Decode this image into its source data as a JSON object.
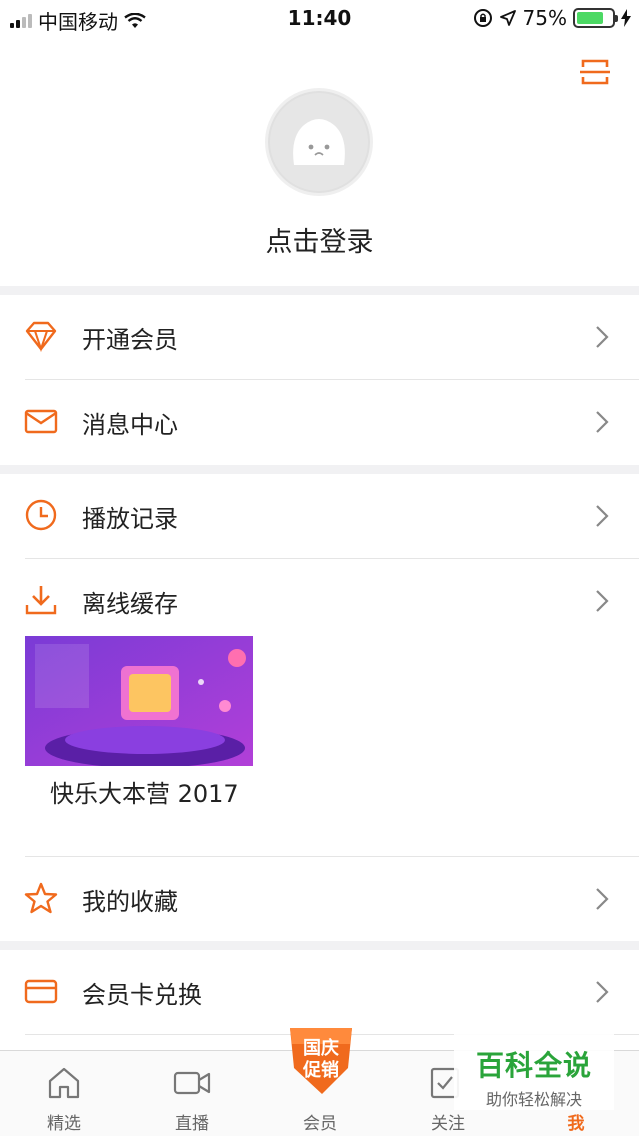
{
  "status_bar": {
    "carrier": "中国移动",
    "time": "11:40",
    "battery_percent": "75%",
    "battery_level": 0.75
  },
  "header": {
    "login_prompt": "点击登录"
  },
  "menu_group_1": [
    {
      "label": "开通会员",
      "icon": "diamond-icon"
    },
    {
      "label": "消息中心",
      "icon": "mail-icon"
    }
  ],
  "menu_group_2": [
    {
      "label": "播放记录",
      "icon": "clock-icon"
    },
    {
      "label": "离线缓存",
      "icon": "download-icon"
    }
  ],
  "offline_video": {
    "title": "快乐大本营 2017"
  },
  "favorites": {
    "label": "我的收藏",
    "icon": "star-icon"
  },
  "menu_group_3": [
    {
      "label": "会员卡兑换",
      "icon": "card-icon"
    }
  ],
  "tab_bar": {
    "tabs": [
      {
        "label": "精选",
        "icon": "home-icon"
      },
      {
        "label": "直播",
        "icon": "video-camera-icon"
      },
      {
        "label": "会员",
        "icon": "promo-badge-icon"
      },
      {
        "label": "关注",
        "icon": "follow-icon"
      },
      {
        "label": "我",
        "icon": "me-icon"
      }
    ],
    "active": "我",
    "promo_badge": "国庆促销"
  },
  "watermark": {
    "title": "百科全说",
    "subtitle": "助你轻松解决"
  },
  "colors": {
    "accent": "#f06a1d",
    "divider": "#f1f1f3",
    "watermark_green": "#2aa43a"
  }
}
